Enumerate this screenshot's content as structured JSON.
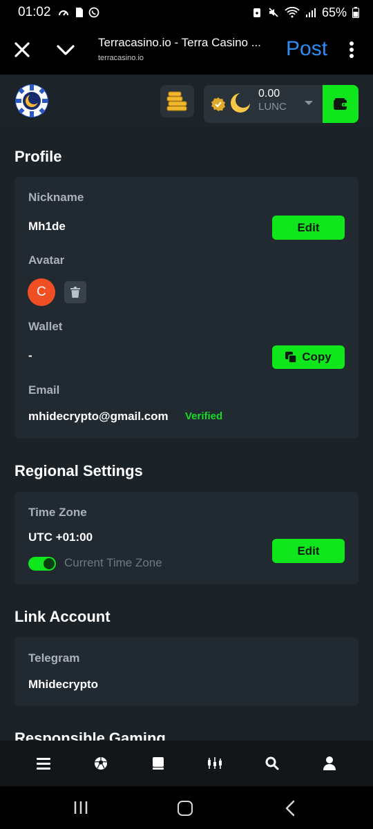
{
  "status_bar": {
    "time": "01:02",
    "battery": "65%"
  },
  "browser": {
    "title": "Terracasino.io - Terra Casino ...",
    "url": "terracasino.io",
    "post_label": "Post"
  },
  "header": {
    "balance_amount": "0.00",
    "balance_currency": "LUNC"
  },
  "profile": {
    "section_title": "Profile",
    "nickname_label": "Nickname",
    "nickname_value": "Mh1de",
    "nickname_edit": "Edit",
    "avatar_label": "Avatar",
    "avatar_letter": "C",
    "wallet_label": "Wallet",
    "wallet_value": "-",
    "copy_label": "Copy",
    "email_label": "Email",
    "email_value": "mhidecrypto@gmail.com",
    "email_status": "Verified"
  },
  "regional": {
    "section_title": "Regional Settings",
    "timezone_label": "Time Zone",
    "timezone_value": "UTC +01:00",
    "edit_label": "Edit",
    "current_tz_label": "Current Time Zone"
  },
  "link_account": {
    "section_title": "Link Account",
    "telegram_label": "Telegram",
    "telegram_value": "Mhidecrypto"
  },
  "responsible": {
    "section_title": "Responsible Gaming"
  },
  "colors": {
    "accent": "#0fe61c",
    "avatar_bg": "#f04e23",
    "post_blue": "#2f8cf5"
  },
  "icons": {
    "bottom_nav": [
      "menu-icon",
      "soccer-ball-icon",
      "book-icon",
      "candlestick-chart-icon",
      "search-icon",
      "user-icon"
    ]
  }
}
